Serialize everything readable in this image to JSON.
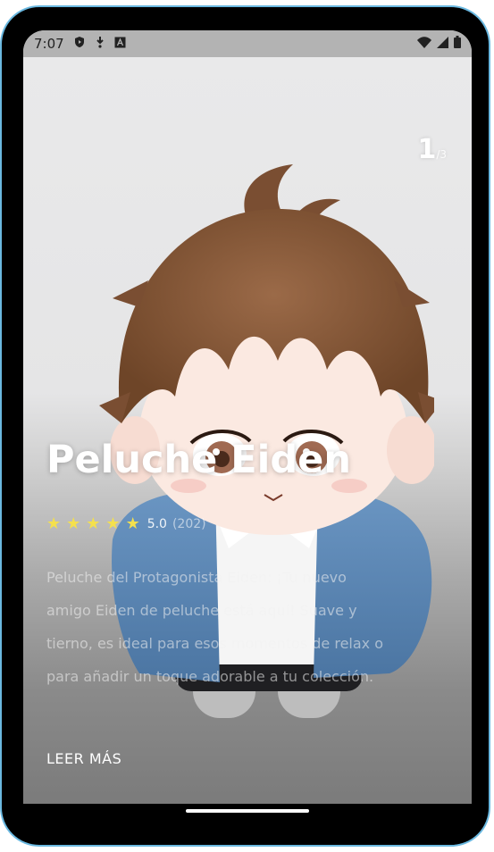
{
  "status_bar": {
    "time": "7:07"
  },
  "slider": {
    "current": "1",
    "total": "/3"
  },
  "product": {
    "title": "Peluche Eiden",
    "rating_value": "5.0",
    "rating_count": "(202)",
    "stars": 5,
    "description": "Peluche del Protagonista Eiden: ¡Tu nuevo amigo Eiden de peluche está aquí! Suave y tierno, es ideal para esos momentos de relax o para añadir un toque adorable a tu colección.",
    "read_more_label": "LEER MÁS"
  },
  "colors": {
    "frame": "#6ab8e0",
    "star": "#f4e04d",
    "hair": "#8a5a3b",
    "jacket": "#5a86b5"
  },
  "icons": [
    "play-protect-icon",
    "download-icon",
    "a-icon",
    "wifi-icon",
    "signal-icon",
    "battery-icon",
    "star-icon"
  ]
}
